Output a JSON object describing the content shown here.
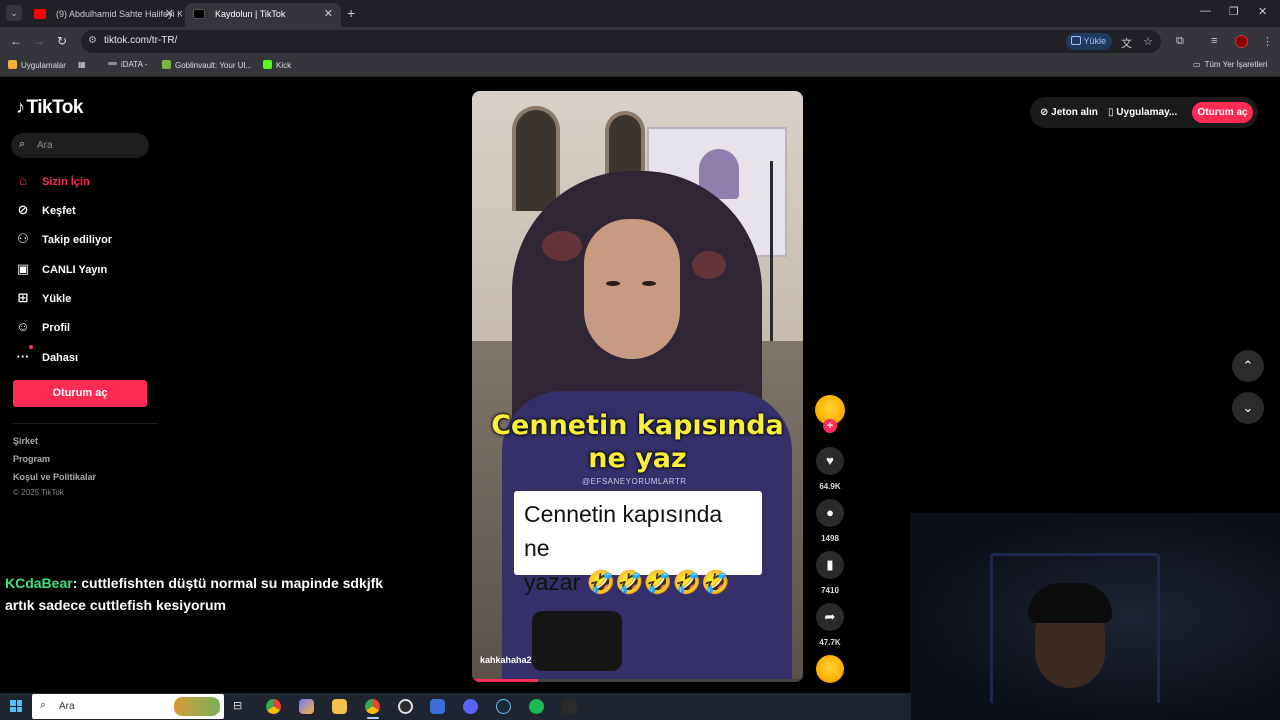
{
  "browser": {
    "tabs": [
      {
        "label": "(9) Abdulhamid Sahte Halifeyi K",
        "favicon_color": "#ff0000"
      },
      {
        "label": "Kaydolun | TikTok",
        "favicon_color": "#000000"
      }
    ],
    "new_tab": "+",
    "url": "tiktok.com/tr-TR/",
    "upload_pill": "Yükle",
    "bookmarks": [
      {
        "label": "Uygulamalar",
        "icon_color": "#f2b233"
      },
      {
        "label": "iDATA -",
        "icon_color": "#8a8a8a"
      },
      {
        "label": "Goblinvault: Your Ul...",
        "icon_color": "#7fb24a"
      },
      {
        "label": "Kick",
        "icon_color": "#53fc18"
      }
    ],
    "all_bookmarks": "Tüm Yer İşaretleri"
  },
  "tiktok": {
    "logo": "TikTok",
    "search_placeholder": "Ara",
    "nav": [
      {
        "label": "Sizin İçin",
        "icon": "home-icon"
      },
      {
        "label": "Keşfet",
        "icon": "compass-icon"
      },
      {
        "label": "Takip ediliyor",
        "icon": "following-icon"
      },
      {
        "label": "CANLI Yayın",
        "icon": "live-tv-icon"
      },
      {
        "label": "Yükle",
        "icon": "upload-icon"
      },
      {
        "label": "Profil",
        "icon": "profile-icon"
      },
      {
        "label": "Dahası",
        "icon": "more-icon"
      }
    ],
    "login_button": "Oturum aç",
    "footer_links": [
      "Şirket",
      "Program",
      "Koşul ve Politikalar"
    ],
    "copyright": "© 2025 TikTok",
    "top_right": {
      "coins": "Jeton alın",
      "app": "Uygulamay...",
      "login": "Oturum aç"
    },
    "video": {
      "caption_line1": "Cennetin kapısında",
      "caption_line2": "ne yaz",
      "watermark": "@EFSANEYORUMLARTR",
      "box_line1": "Cennetin kapısında ne",
      "box_line2": "yazar 🤣🤣🤣🤣🤣",
      "username": "kahkahaha2",
      "progress": 0.2
    },
    "actions": {
      "likes": "64.9K",
      "comments": "1498",
      "saves": "7410",
      "shares": "47.7K"
    }
  },
  "chat_overlay": {
    "user": "KCdaBear",
    "message": ": cuttlefishten düştü normal su mapinde sdkjfk artık sadece cuttlefish kesiyorum"
  },
  "taskbar": {
    "search_placeholder": "Ara"
  },
  "colors": {
    "accent": "#fe2c55",
    "chat_user": "#3ee07a",
    "caption": "#f7ef3a"
  }
}
